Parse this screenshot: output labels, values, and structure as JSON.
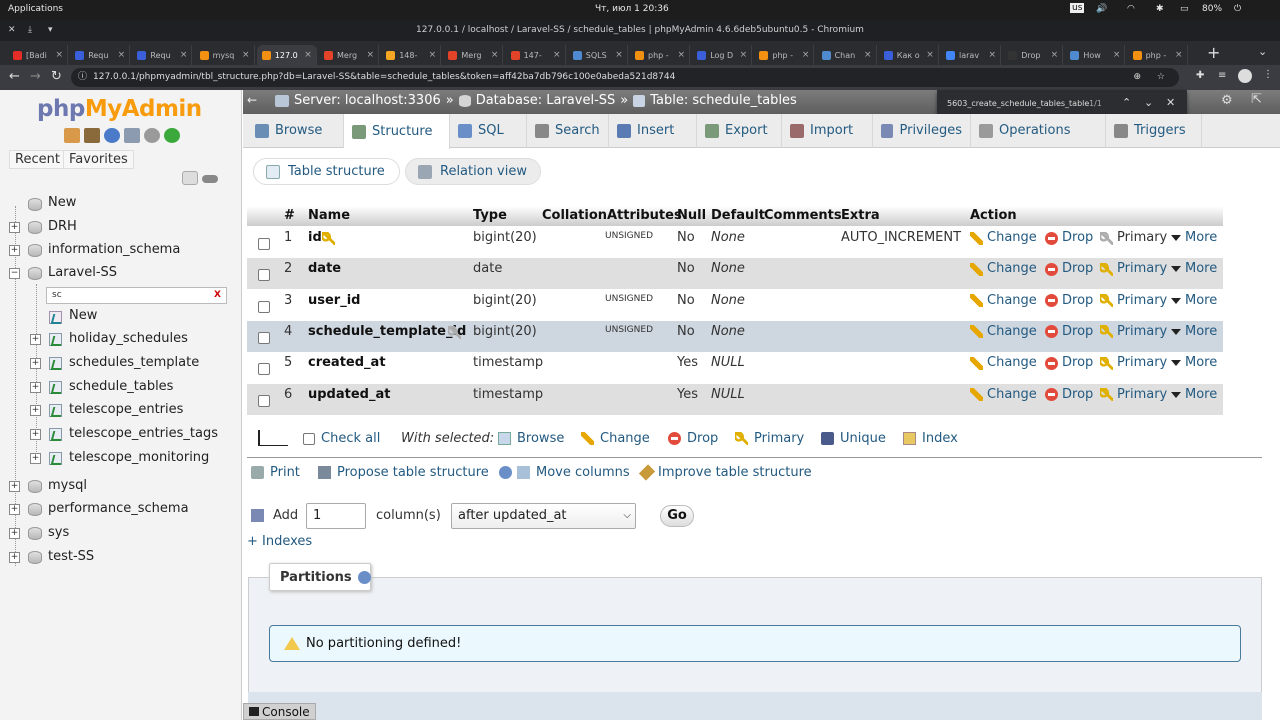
{
  "os": {
    "apps": "Applications",
    "clock": "Чт, июл  1   20:36",
    "lang": "us",
    "battery": "80%"
  },
  "window_title": "127.0.0.1 / localhost / Laravel-SS / schedule_tables | phpMyAdmin 4.6.6deb5ubuntu0.5 - Chromium",
  "tabs": [
    {
      "label": "[Badi",
      "color": "#e52d27"
    },
    {
      "label": "Requ",
      "color": "#3a5fd9"
    },
    {
      "label": "Requ",
      "color": "#3a5fd9"
    },
    {
      "label": "mysq",
      "color": "#f29111"
    },
    {
      "label": "127.0",
      "color": "#f29111"
    },
    {
      "label": "Merg",
      "color": "#e24329"
    },
    {
      "label": "148-",
      "color": "#f5a623"
    },
    {
      "label": "Merg",
      "color": "#e24329"
    },
    {
      "label": "147-",
      "color": "#e24329"
    },
    {
      "label": "SQLS",
      "color": "#4f8ad1"
    },
    {
      "label": "php -",
      "color": "#f29111"
    },
    {
      "label": "Log D",
      "color": "#3a5fd9"
    },
    {
      "label": "php -",
      "color": "#f29111"
    },
    {
      "label": "Chan",
      "color": "#4f8ad1"
    },
    {
      "label": "Как о",
      "color": "#3a5fd9"
    },
    {
      "label": "larav",
      "color": "#4285f4"
    },
    {
      "label": "Drop",
      "color": "#333333"
    },
    {
      "label": "How",
      "color": "#4f8ad1"
    },
    {
      "label": "php -",
      "color": "#f29111"
    }
  ],
  "url": "127.0.0.1/phpmyadmin/tbl_structure.php?db=Laravel-SS&table=schedule_tables&token=aff42ba7db796c100e0abeda521d8744",
  "sidebar": {
    "recent": "Recent",
    "favorites": "Favorites",
    "new": "New",
    "dbs_top": [
      "DRH",
      "information_schema",
      "Laravel-SS"
    ],
    "filter_value": "sc",
    "filter_clear": "X",
    "table_new": "New",
    "tables": [
      "holiday_schedules",
      "schedules_template",
      "schedule_tables",
      "telescope_entries",
      "telescope_entries_tags",
      "telescope_monitoring"
    ],
    "dbs_bottom": [
      "mysql",
      "performance_schema",
      "sys",
      "test-SS"
    ]
  },
  "breadcrumb": {
    "server": "Server: localhost:3306",
    "sep": "»",
    "database": "Database: Laravel-SS",
    "table": "Table: schedule_tables"
  },
  "find": {
    "query": "5603_create_schedule_tables_table",
    "count": "1/1"
  },
  "menu": [
    "Browse",
    "Structure",
    "SQL",
    "Search",
    "Insert",
    "Export",
    "Import",
    "Privileges",
    "Operations",
    "Triggers"
  ],
  "subtabs": [
    "Table structure",
    "Relation view"
  ],
  "columns": [
    "#",
    "Name",
    "Type",
    "Collation",
    "Attributes",
    "Null",
    "Default",
    "Comments",
    "Extra",
    "Action"
  ],
  "rows": [
    {
      "num": "1",
      "name": "id",
      "type": "bigint(20)",
      "attr": "UNSIGNED",
      "null": "No",
      "default": "None",
      "extra": "AUTO_INCREMENT"
    },
    {
      "num": "2",
      "name": "date",
      "type": "date",
      "attr": "",
      "null": "No",
      "default": "None",
      "extra": ""
    },
    {
      "num": "3",
      "name": "user_id",
      "type": "bigint(20)",
      "attr": "UNSIGNED",
      "null": "No",
      "default": "None",
      "extra": ""
    },
    {
      "num": "4",
      "name": "schedule_template_id",
      "type": "bigint(20)",
      "attr": "UNSIGNED",
      "null": "No",
      "default": "None",
      "extra": ""
    },
    {
      "num": "5",
      "name": "created_at",
      "type": "timestamp",
      "attr": "",
      "null": "Yes",
      "default": "NULL",
      "extra": ""
    },
    {
      "num": "6",
      "name": "updated_at",
      "type": "timestamp",
      "attr": "",
      "null": "Yes",
      "default": "NULL",
      "extra": ""
    }
  ],
  "actions": {
    "change": "Change",
    "drop": "Drop",
    "primary": "Primary",
    "more": "More"
  },
  "bulk": {
    "check_all": "Check all",
    "with_selected": "With selected:",
    "browse": "Browse",
    "change": "Change",
    "drop": "Drop",
    "primary": "Primary",
    "unique": "Unique",
    "index": "Index"
  },
  "tools": {
    "print": "Print",
    "propose": "Propose table structure",
    "move": "Move columns",
    "improve": "Improve table structure"
  },
  "add": {
    "label": "Add",
    "count": "1",
    "columns": "column(s)",
    "position": "after updated_at",
    "go": "Go"
  },
  "indexes": "+ Indexes",
  "partitions": {
    "title": "Partitions",
    "message": "No partitioning defined!"
  },
  "console": "Console"
}
